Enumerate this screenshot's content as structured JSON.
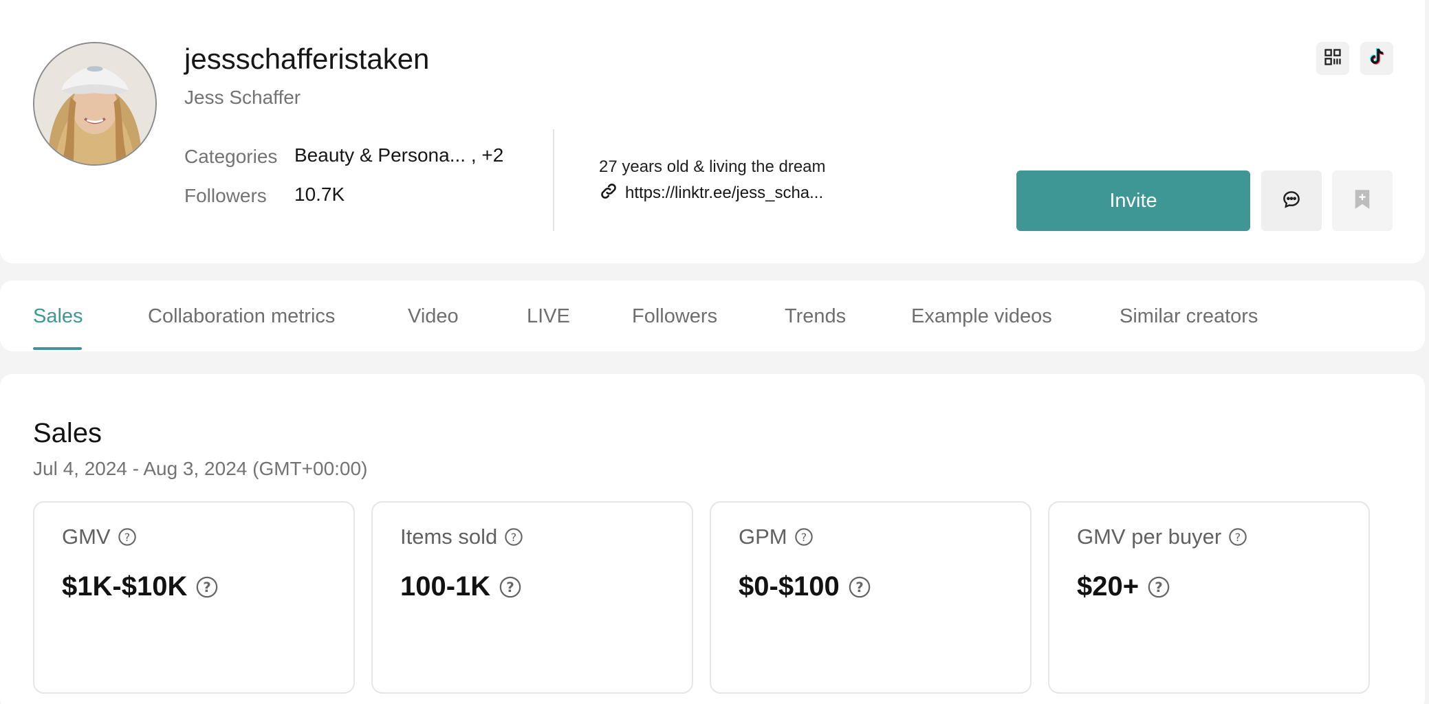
{
  "profile": {
    "handle": "jessschafferistaken",
    "name": "Jess Schaffer",
    "categories_label": "Categories",
    "categories_value": "Beauty & Persona... , +2",
    "followers_label": "Followers",
    "followers_value": "10.7K",
    "bio": "27 years old & living the dream",
    "link": "https://linktr.ee/jess_scha..."
  },
  "actions": {
    "invite_label": "Invite"
  },
  "icons": {
    "qr": "qr-code-icon",
    "tiktok": "tiktok-icon",
    "message": "message-icon",
    "bookmark": "bookmark-add-icon",
    "link": "link-icon",
    "help": "help-icon"
  },
  "colors": {
    "accent": "#3f9795",
    "background": "#f4f4f4"
  },
  "tabs": [
    {
      "label": "Sales",
      "active": true
    },
    {
      "label": "Collaboration metrics",
      "active": false
    },
    {
      "label": "Video",
      "active": false
    },
    {
      "label": "LIVE",
      "active": false
    },
    {
      "label": "Followers",
      "active": false
    },
    {
      "label": "Trends",
      "active": false
    },
    {
      "label": "Example videos",
      "active": false
    },
    {
      "label": "Similar creators",
      "active": false
    }
  ],
  "sales": {
    "title": "Sales",
    "date_range": "Jul 4, 2024 - Aug 3, 2024 (GMT+00:00)",
    "metrics": [
      {
        "label": "GMV",
        "value": "$1K-$10K"
      },
      {
        "label": "Items sold",
        "value": "100-1K"
      },
      {
        "label": "GPM",
        "value": "$0-$100"
      },
      {
        "label": "GMV per buyer",
        "value": "$20+"
      }
    ]
  }
}
